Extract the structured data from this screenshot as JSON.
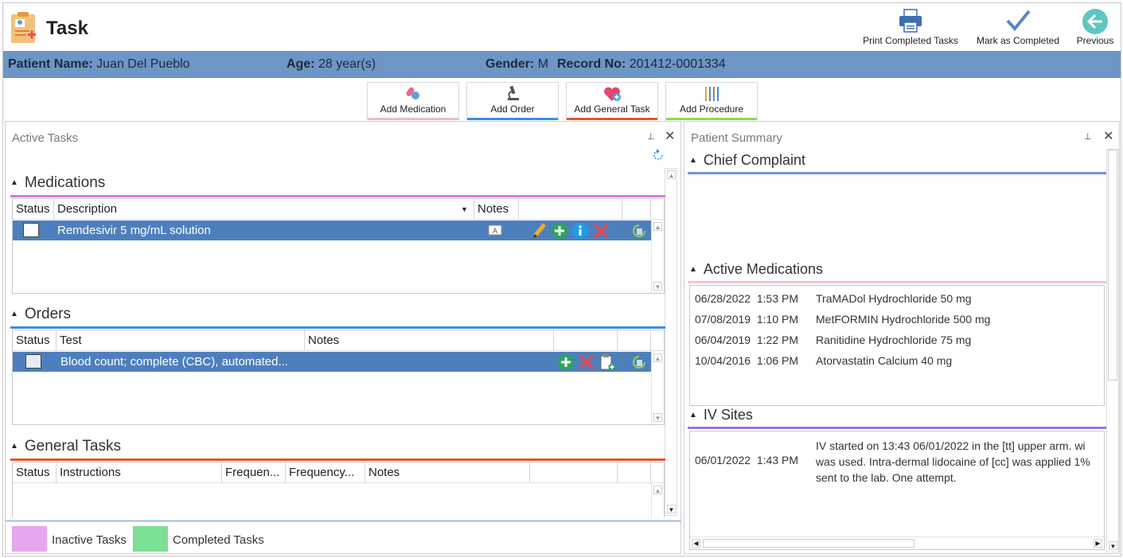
{
  "header": {
    "title": "Task",
    "print_label": "Print Completed Tasks",
    "complete_label": "Mark as Completed",
    "previous_label": "Previous"
  },
  "patient": {
    "name_label": "Patient Name:",
    "name": "Juan Del Pueblo",
    "age_label": "Age:",
    "age": "28 year(s)",
    "gender_label": "Gender:",
    "gender": "M",
    "record_label": "Record No:",
    "record": "201412-0001334"
  },
  "add_buttons": [
    {
      "label": "Add Medication",
      "color": "#f4b6c2"
    },
    {
      "label": "Add Order",
      "color": "#3c8fdc"
    },
    {
      "label": "Add General Task",
      "color": "#e2542a"
    },
    {
      "label": "Add Procedure",
      "color": "#8ed94e"
    }
  ],
  "active_tasks": {
    "title": "Active Tasks",
    "medications": {
      "heading": "Medications",
      "color": "#d978d9",
      "columns": [
        "Status",
        "Description",
        "Notes"
      ],
      "rows": [
        {
          "description": "Remdesivir 5 mg/mL solution"
        }
      ]
    },
    "orders": {
      "heading": "Orders",
      "color": "#3c8fdc",
      "columns": [
        "Status",
        "Test",
        "Notes"
      ],
      "rows": [
        {
          "test": "Blood count; complete (CBC), automated..."
        }
      ]
    },
    "general_tasks": {
      "heading": "General Tasks",
      "color": "#e2542a",
      "columns": [
        "Status",
        "Instructions",
        "Frequen...",
        "Frequency...",
        "Notes"
      ]
    },
    "legend": {
      "inactive": "Inactive Tasks",
      "inactive_color": "#e6a6ef",
      "completed": "Completed Tasks",
      "completed_color": "#7be094"
    }
  },
  "patient_summary": {
    "title": "Patient Summary",
    "chief_complaint": {
      "heading": "Chief Complaint",
      "color": "#6d95d8"
    },
    "active_medications": {
      "heading": "Active Medications",
      "color": "#f4c4cc",
      "rows": [
        {
          "date": "06/28/2022",
          "time": "1:53 PM",
          "drug": "TraMADol Hydrochloride",
          "dose": "50 mg"
        },
        {
          "date": "07/08/2019",
          "time": "1:10 PM",
          "drug": "MetFORMIN Hydrochloride",
          "dose": "500 mg"
        },
        {
          "date": "06/04/2019",
          "time": "1:22 PM",
          "drug": "Ranitidine Hydrochloride",
          "dose": "75 mg"
        },
        {
          "date": "10/04/2016",
          "time": "1:06 PM",
          "drug": "Atorvastatin Calcium",
          "dose": "40 mg"
        }
      ]
    },
    "iv_sites": {
      "heading": "IV Sites",
      "color": "#9b78d6",
      "date": "06/01/2022",
      "time": "1:43 PM",
      "lines": [
        "IV started on 13:43 06/01/2022 in the [tt] upper arm. wi",
        "was used. Intra-dermal lidocaine of [cc] was applied 1%",
        "sent to the lab.  One attempt."
      ]
    }
  }
}
